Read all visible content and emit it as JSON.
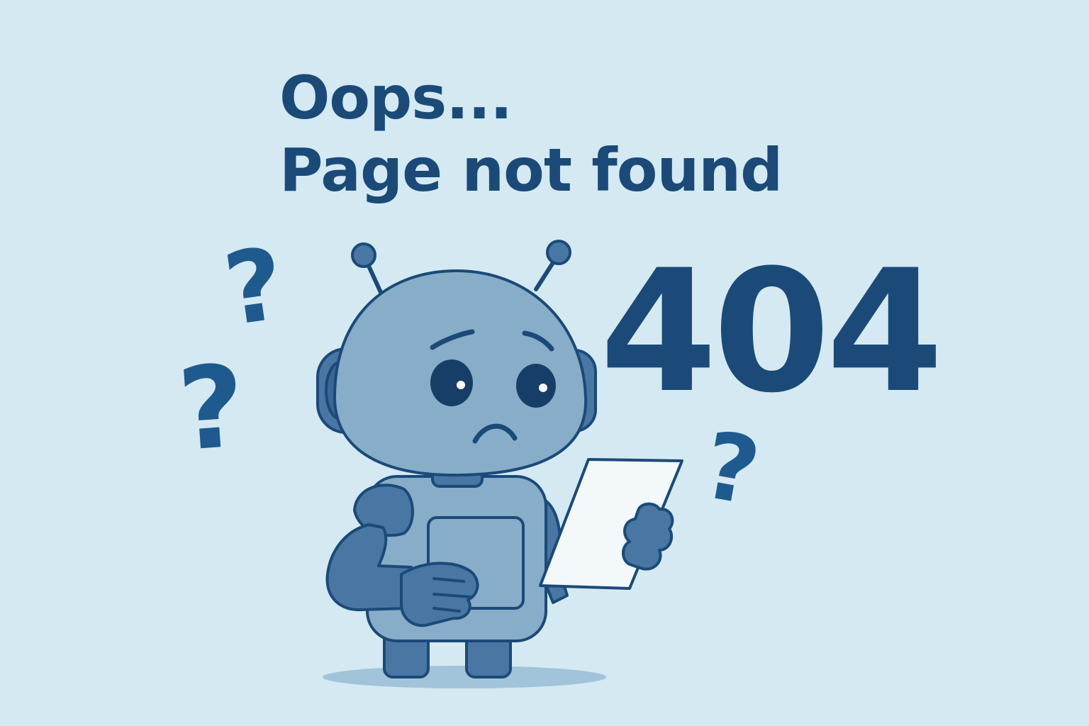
{
  "message": {
    "line1": "Oops...",
    "line2": "Page not found"
  },
  "error_code": "404",
  "decorations": {
    "question_mark": "?"
  },
  "illustration": {
    "subject": "robot-icon",
    "held_item": "paper-sheet-icon"
  },
  "colors": {
    "background": "#d4e9f2",
    "text": "#1b4a78",
    "robot_body": "#88adc9",
    "robot_dark": "#4a76a4",
    "outline": "#1b4a78",
    "paper": "#f3f8fb"
  }
}
